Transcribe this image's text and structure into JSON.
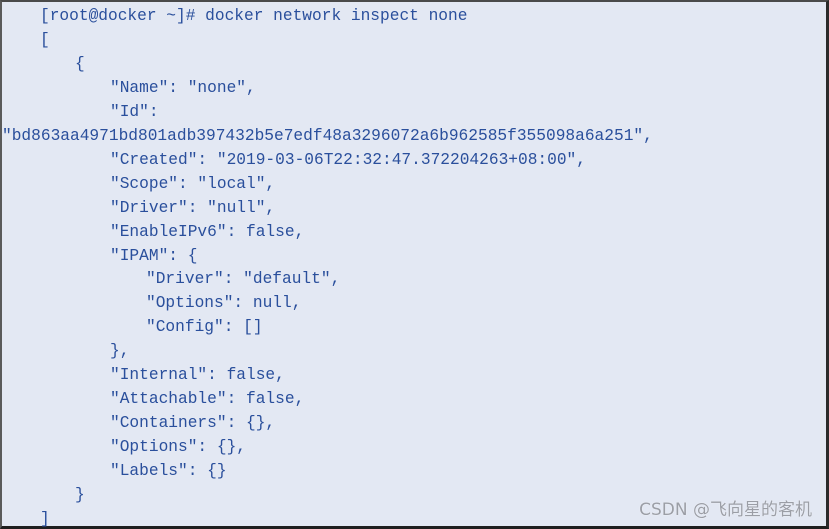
{
  "terminal": {
    "prompt": "[root@docker ~]#",
    "command": "docker network inspect none",
    "output_lines": [
      {
        "indent": 0,
        "text": "["
      },
      {
        "indent": 1,
        "text": "{"
      },
      {
        "indent": 2,
        "text": "\"Name\": \"none\","
      },
      {
        "indent": 2,
        "text": "\"Id\":"
      },
      {
        "indent": -1,
        "text": "\"bd863aa4971bd801adb397432b5e7edf48a3296072a6b962585f355098a6a251\","
      },
      {
        "indent": 2,
        "text": "\"Created\": \"2019-03-06T22:32:47.372204263+08:00\","
      },
      {
        "indent": 2,
        "text": "\"Scope\": \"local\","
      },
      {
        "indent": 2,
        "text": "\"Driver\": \"null\","
      },
      {
        "indent": 2,
        "text": "\"EnableIPv6\": false,"
      },
      {
        "indent": 2,
        "text": "\"IPAM\": {"
      },
      {
        "indent": 3,
        "text": "\"Driver\": \"default\","
      },
      {
        "indent": 3,
        "text": "\"Options\": null,"
      },
      {
        "indent": 3,
        "text": "\"Config\": []"
      },
      {
        "indent": 2,
        "text": "},"
      },
      {
        "indent": 2,
        "text": "\"Internal\": false,"
      },
      {
        "indent": 2,
        "text": "\"Attachable\": false,"
      },
      {
        "indent": 2,
        "text": "\"Containers\": {},"
      },
      {
        "indent": 2,
        "text": "\"Options\": {},"
      },
      {
        "indent": 2,
        "text": "\"Labels\": {}"
      },
      {
        "indent": 1,
        "text": "}"
      },
      {
        "indent": 0,
        "text": "]"
      }
    ]
  },
  "watermark": "CSDN @飞向星的客机",
  "colors": {
    "background": "#e3e8f3",
    "text": "#2a4f9c",
    "watermark": "#9b9ea6"
  }
}
